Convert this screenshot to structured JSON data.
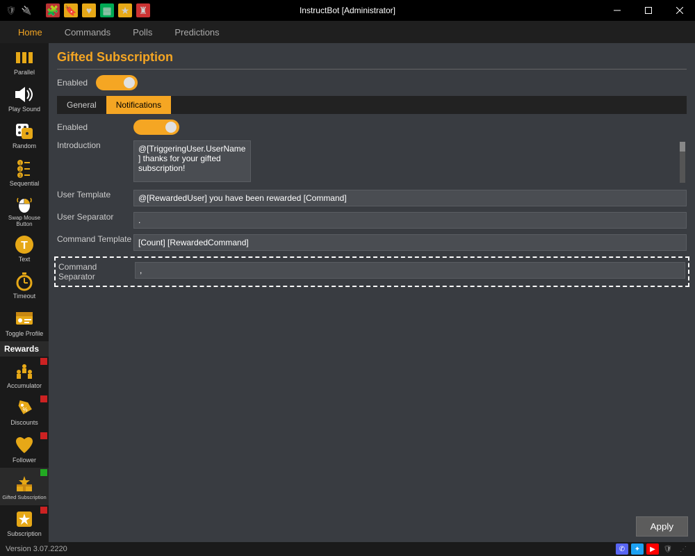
{
  "window": {
    "title": "InstructBot [Administrator]"
  },
  "menu": {
    "items": [
      {
        "label": "Home",
        "active": true
      },
      {
        "label": "Commands",
        "active": false
      },
      {
        "label": "Polls",
        "active": false
      },
      {
        "label": "Predictions",
        "active": false
      }
    ]
  },
  "sidebar": {
    "items": [
      {
        "label": "Parallel",
        "icon": "parallel",
        "marker": null
      },
      {
        "label": "Play Sound",
        "icon": "sound",
        "marker": null
      },
      {
        "label": "Random",
        "icon": "dice",
        "marker": null
      },
      {
        "label": "Sequential",
        "icon": "sequential",
        "marker": null
      },
      {
        "label": "Swap Mouse Button",
        "icon": "mouse",
        "marker": null
      },
      {
        "label": "Text",
        "icon": "text",
        "marker": null
      },
      {
        "label": "Timeout",
        "icon": "timeout",
        "marker": null
      },
      {
        "label": "Toggle Profile",
        "icon": "profile",
        "marker": null
      }
    ],
    "rewards_header": "Rewards",
    "rewards": [
      {
        "label": "Accumulator",
        "icon": "accumulator",
        "marker": "red"
      },
      {
        "label": "Discounts",
        "icon": "discounts",
        "marker": "red"
      },
      {
        "label": "Follower",
        "icon": "heart",
        "marker": "red"
      },
      {
        "label": "Gifted Subscription",
        "icon": "gift",
        "marker": "green",
        "active": true
      },
      {
        "label": "Subscription",
        "icon": "star",
        "marker": "red"
      }
    ]
  },
  "page": {
    "title": "Gifted Subscription",
    "enabled_label": "Enabled",
    "tabs": [
      {
        "label": "General",
        "active": false
      },
      {
        "label": "Notifications",
        "active": true
      }
    ],
    "form": {
      "enabled_label": "Enabled",
      "introduction_label": "Introduction",
      "introduction_value": "@[TriggeringUser.UserName] thanks for your gifted subscription!",
      "user_template_label": "User Template",
      "user_template_value": "@[RewardedUser] you have been rewarded [Command]",
      "user_separator_label": "User Separator",
      "user_separator_value": ".",
      "command_template_label": "Command Template",
      "command_template_value": "[Count] [RewardedCommand]",
      "command_separator_label": "Command Separator",
      "command_separator_value": ","
    },
    "apply_label": "Apply"
  },
  "statusbar": {
    "version": "Version 3.07.2220"
  }
}
